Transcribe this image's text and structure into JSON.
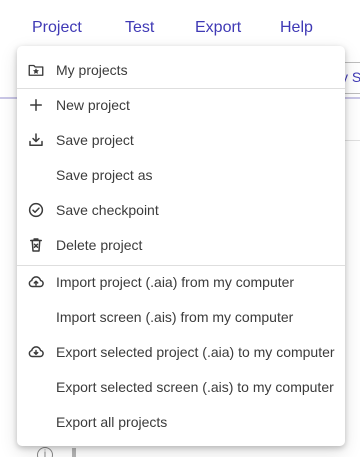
{
  "menubar": {
    "items": [
      {
        "label": "Project"
      },
      {
        "label": "Test"
      },
      {
        "label": "Export"
      },
      {
        "label": "Help"
      }
    ]
  },
  "background": {
    "field_text": "y S",
    "info_glyph": "i"
  },
  "dropdown": {
    "items": [
      {
        "label": "My projects",
        "icon": "folder-star-icon"
      },
      {
        "label": "New project",
        "icon": "plus-icon"
      },
      {
        "label": "Save project",
        "icon": "download-tray-icon"
      },
      {
        "label": "Save project as",
        "icon": ""
      },
      {
        "label": "Save checkpoint",
        "icon": "check-circle-icon"
      },
      {
        "label": "Delete project",
        "icon": "trash-icon"
      },
      {
        "label": "Import project (.aia) from my computer",
        "icon": "cloud-upload-icon"
      },
      {
        "label": "Import screen (.ais) from my computer",
        "icon": ""
      },
      {
        "label": "Export selected project (.aia) to my computer",
        "icon": "cloud-download-icon"
      },
      {
        "label": "Export selected screen (.ais) to my computer",
        "icon": ""
      },
      {
        "label": "Export all projects",
        "icon": ""
      }
    ]
  },
  "colors": {
    "menu_text": "#3f39b5",
    "item_text": "#3b3b3b",
    "icon": "#3b3b3b"
  }
}
